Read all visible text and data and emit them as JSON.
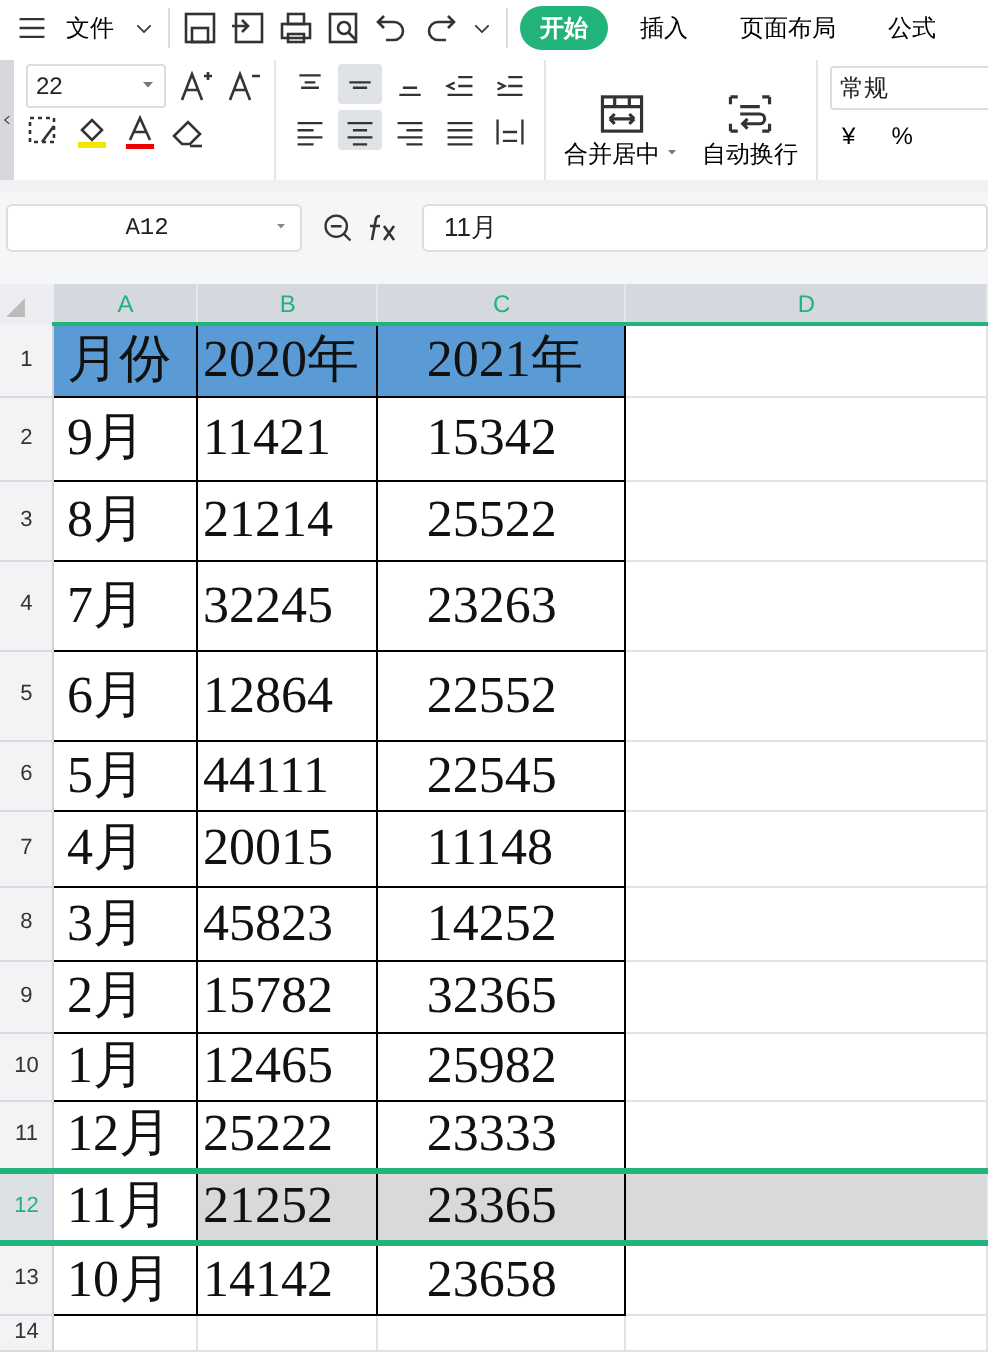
{
  "menu": {
    "label": "文件",
    "tabs": [
      {
        "label": "开始",
        "selected": true
      },
      {
        "label": "插入",
        "selected": false
      },
      {
        "label": "页面布局",
        "selected": false
      },
      {
        "label": "公式",
        "selected": false
      }
    ]
  },
  "ribbon": {
    "font_size": "22",
    "merge_button": "合并居中",
    "wrap_button": "自动换行",
    "number_format": "常规",
    "currency": "¥",
    "percent": "%"
  },
  "formula_bar": {
    "cell_ref": "A12",
    "value": "11月"
  },
  "sheet": {
    "columns": [
      {
        "label": "A",
        "selected": true
      },
      {
        "label": "B",
        "selected": true
      },
      {
        "label": "C",
        "selected": true
      },
      {
        "label": "D",
        "selected": true
      }
    ],
    "rows": [
      {
        "number": "1",
        "kind": "header",
        "selected": false,
        "cells": [
          "月份",
          "2020年",
          "2021年"
        ]
      },
      {
        "number": "2",
        "kind": "data",
        "selected": false,
        "cells": [
          "9月",
          "11421",
          "15342"
        ]
      },
      {
        "number": "3",
        "kind": "data",
        "selected": false,
        "cells": [
          "8月",
          "21214",
          "25522"
        ]
      },
      {
        "number": "4",
        "kind": "data",
        "selected": false,
        "cells": [
          "7月",
          "32245",
          "23263"
        ]
      },
      {
        "number": "5",
        "kind": "data",
        "selected": false,
        "cells": [
          "6月",
          "12864",
          "22552"
        ]
      },
      {
        "number": "6",
        "kind": "data",
        "selected": false,
        "cells": [
          "5月",
          "44111",
          "22545"
        ]
      },
      {
        "number": "7",
        "kind": "data",
        "selected": false,
        "cells": [
          "4月",
          "20015",
          "11148"
        ]
      },
      {
        "number": "8",
        "kind": "data",
        "selected": false,
        "cells": [
          "3月",
          "45823",
          "14252"
        ]
      },
      {
        "number": "9",
        "kind": "data",
        "selected": false,
        "cells": [
          "2月",
          "15782",
          "32365"
        ]
      },
      {
        "number": "10",
        "kind": "data",
        "selected": false,
        "cells": [
          "1月",
          "12465",
          "25982"
        ]
      },
      {
        "number": "11",
        "kind": "data",
        "selected": false,
        "cells": [
          "12月",
          "25222",
          "23333"
        ]
      },
      {
        "number": "12",
        "kind": "data",
        "selected": true,
        "cells": [
          "11月",
          "21252",
          "23365"
        ]
      },
      {
        "number": "13",
        "kind": "data",
        "selected": false,
        "cells": [
          "10月",
          "14142",
          "23658"
        ]
      },
      {
        "number": "14",
        "kind": "empty",
        "selected": false,
        "cells": []
      }
    ]
  }
}
